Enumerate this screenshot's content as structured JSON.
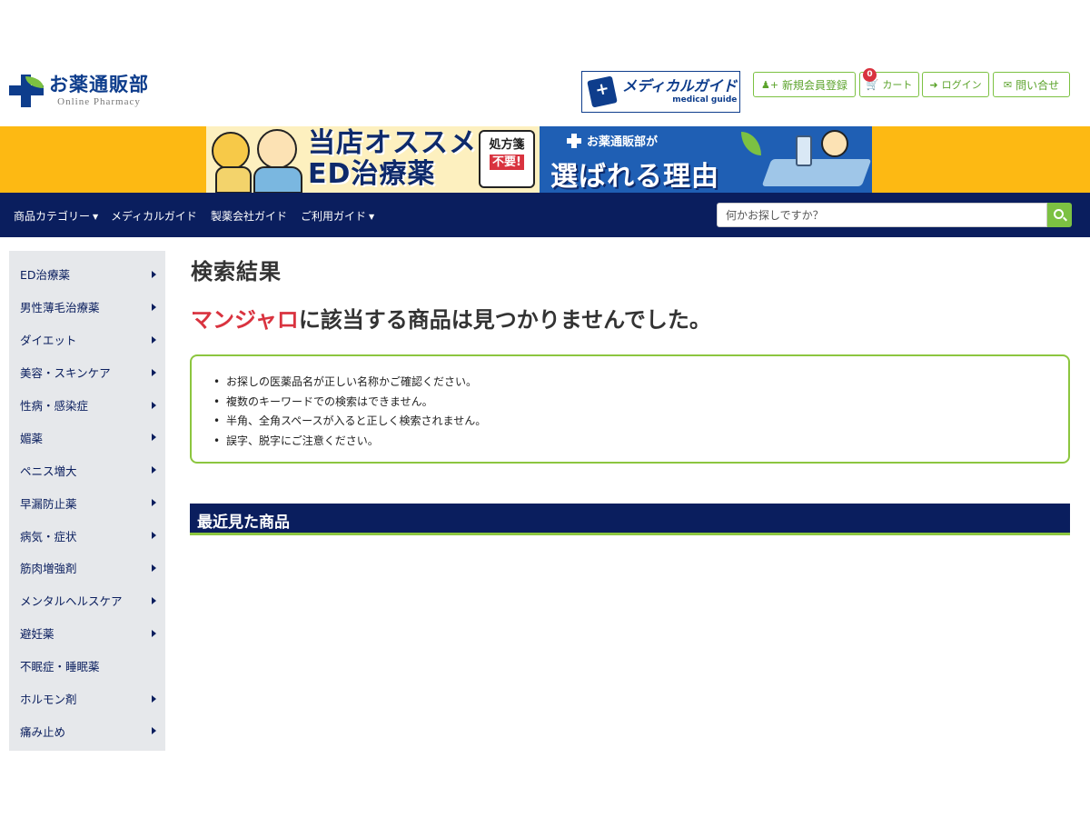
{
  "header": {
    "logo_title": "お薬通販部",
    "logo_sub": "Online Pharmacy",
    "medical_guide_title": "メディカルガイド",
    "medical_guide_sub": "medical guide",
    "register_label": "新規会員登録",
    "cart_label": "カート",
    "cart_count": "0",
    "login_label": "ログイン",
    "contact_label": "問い合せ"
  },
  "banner": {
    "headline": "当店オススメ\nED治療薬",
    "stamp_line1": "処方箋",
    "stamp_line2": "不要!",
    "brand_small": "お薬通販部が",
    "brand_big": "選ばれる理由"
  },
  "nav": {
    "items": [
      {
        "label": "商品カテゴリー",
        "has_caret": true
      },
      {
        "label": "メディカルガイド",
        "has_caret": false
      },
      {
        "label": "製薬会社ガイド",
        "has_caret": false
      },
      {
        "label": "ご利用ガイド",
        "has_caret": true
      }
    ],
    "search_placeholder": "何かお探しですか？"
  },
  "sidebar": {
    "items": [
      {
        "label": "ED治療薬",
        "arrow": true
      },
      {
        "label": "男性薄毛治療薬",
        "arrow": true
      },
      {
        "label": "ダイエット",
        "arrow": true
      },
      {
        "label": "美容・スキンケア",
        "arrow": true
      },
      {
        "label": "性病・感染症",
        "arrow": true
      },
      {
        "label": "媚薬",
        "arrow": true
      },
      {
        "label": "ペニス増大",
        "arrow": true
      },
      {
        "label": "早漏防止薬",
        "arrow": true
      },
      {
        "label": "病気・症状",
        "arrow": true
      },
      {
        "label": "筋肉増強剤",
        "arrow": true
      },
      {
        "label": "メンタルヘルスケア",
        "arrow": true
      },
      {
        "label": "避妊薬",
        "arrow": true
      },
      {
        "label": "不眠症・睡眠薬",
        "arrow": false
      },
      {
        "label": "ホルモン剤",
        "arrow": true
      },
      {
        "label": "痛み止め",
        "arrow": true
      }
    ]
  },
  "main": {
    "title": "検索結果",
    "keyword": "マンジャロ",
    "result_suffix": "に該当する商品は見つかりませんでした。",
    "tips": [
      "お探しの医薬品名が正しい名称かご確認ください。",
      "複数のキーワードでの検索はできません。",
      "半角、全角スペースが入ると正しく検索されません。",
      "誤字、脱字にご注意ください。"
    ],
    "recent_heading": "最近見た商品"
  },
  "colors": {
    "navy": "#0a1e5e",
    "green": "#7cc142",
    "banner_yellow": "#fdb913",
    "keyword_red": "#d9333f"
  }
}
